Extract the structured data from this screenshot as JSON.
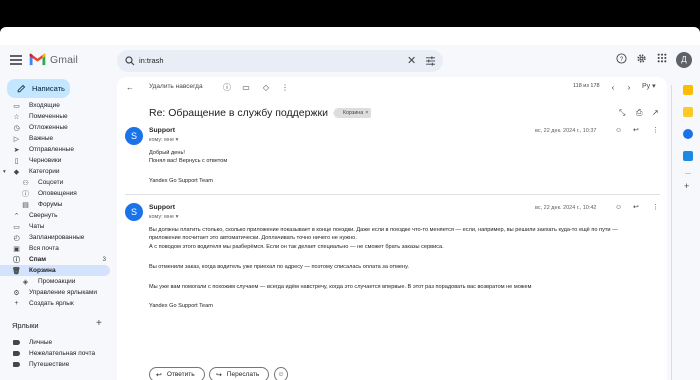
{
  "app": {
    "name": "Gmail"
  },
  "search": {
    "query": "in:trash"
  },
  "header": {
    "avatar_letter": "Д"
  },
  "compose": {
    "label": "Написать"
  },
  "nav": {
    "items": [
      {
        "label": "Входящие",
        "icon": "inbox-icon",
        "count": ""
      },
      {
        "label": "Помеченные",
        "icon": "star-icon",
        "count": ""
      },
      {
        "label": "Отложенные",
        "icon": "clock-icon",
        "count": ""
      },
      {
        "label": "Важные",
        "icon": "important-icon",
        "count": ""
      },
      {
        "label": "Отправленные",
        "icon": "send-icon",
        "count": ""
      },
      {
        "label": "Черновики",
        "icon": "draft-icon",
        "count": ""
      },
      {
        "label": "Категории",
        "icon": "label-icon",
        "count": ""
      },
      {
        "label": "Соцсети",
        "icon": "people-icon",
        "count": ""
      },
      {
        "label": "Оповещения",
        "icon": "info-icon",
        "count": ""
      },
      {
        "label": "Форумы",
        "icon": "forum-icon",
        "count": ""
      },
      {
        "label": "Свернуть",
        "icon": "chevron-up-icon",
        "count": ""
      },
      {
        "label": "Чаты",
        "icon": "chat-icon",
        "count": ""
      },
      {
        "label": "Запланированные",
        "icon": "scheduled-icon",
        "count": ""
      },
      {
        "label": "Вся почта",
        "icon": "all-mail-icon",
        "count": ""
      },
      {
        "label": "Спам",
        "icon": "spam-icon",
        "count": "3"
      },
      {
        "label": "Корзина",
        "icon": "trash-icon",
        "count": ""
      },
      {
        "label": "Промоакции",
        "icon": "promo-icon",
        "count": ""
      },
      {
        "label": "Управление ярлыками",
        "icon": "settings-icon",
        "count": ""
      },
      {
        "label": "Создать ярлык",
        "icon": "plus-icon",
        "count": ""
      }
    ],
    "labels_title": "Ярлыки",
    "labels": [
      "Личные",
      "Нежелательная почта",
      "Путешествие"
    ]
  },
  "toolbar": {
    "delete_forever": "Удалить навсегда",
    "pager": "118 из 178",
    "lang": "Ру"
  },
  "thread": {
    "subject": "Re: Обращение в службу поддержки",
    "label_badge": "Корзина",
    "messages": [
      {
        "avatar": "S",
        "sender": "Support",
        "to": "кому: мне",
        "date": "вс, 22 дек. 2024 г., 10:37",
        "lines": [
          "Добрый день!",
          "Понял вас! Вернусь с ответом",
          "Yandex Go Support Team"
        ]
      },
      {
        "avatar": "S",
        "sender": "Support",
        "to": "кому: мне",
        "date": "вс, 22 дек. 2024 г., 10:42",
        "lines": [
          "Вы должны платить столько, сколько приложение показывает в конце поездки. Даже если в поездке что-то меняется — если, например, вы решили заехать куда-то ещё по пути —",
          "приложение посчитает это автоматически. Доплачивать точно ничего не нужно.",
          "А с поводом этого водителя мы разберёмся. Если он так делает специально — не сможет брать заказы сервиса.",
          "Вы отменили заказ, когда водитель уже приехал по адресу — поэтому списалась оплата за отмену.",
          "Мы уже вам помогали с похожим случаем — всегда идём навстречу, когда это случается впервые. В этот раз порадовать вас возвратом не можем",
          "Yandex Go Support Team"
        ]
      }
    ],
    "reply_label": "Ответить",
    "forward_label": "Переслать"
  },
  "colors": {
    "accent": "#c2e7ff",
    "active": "#d3e3fd",
    "avatar": "#1a73e8"
  }
}
